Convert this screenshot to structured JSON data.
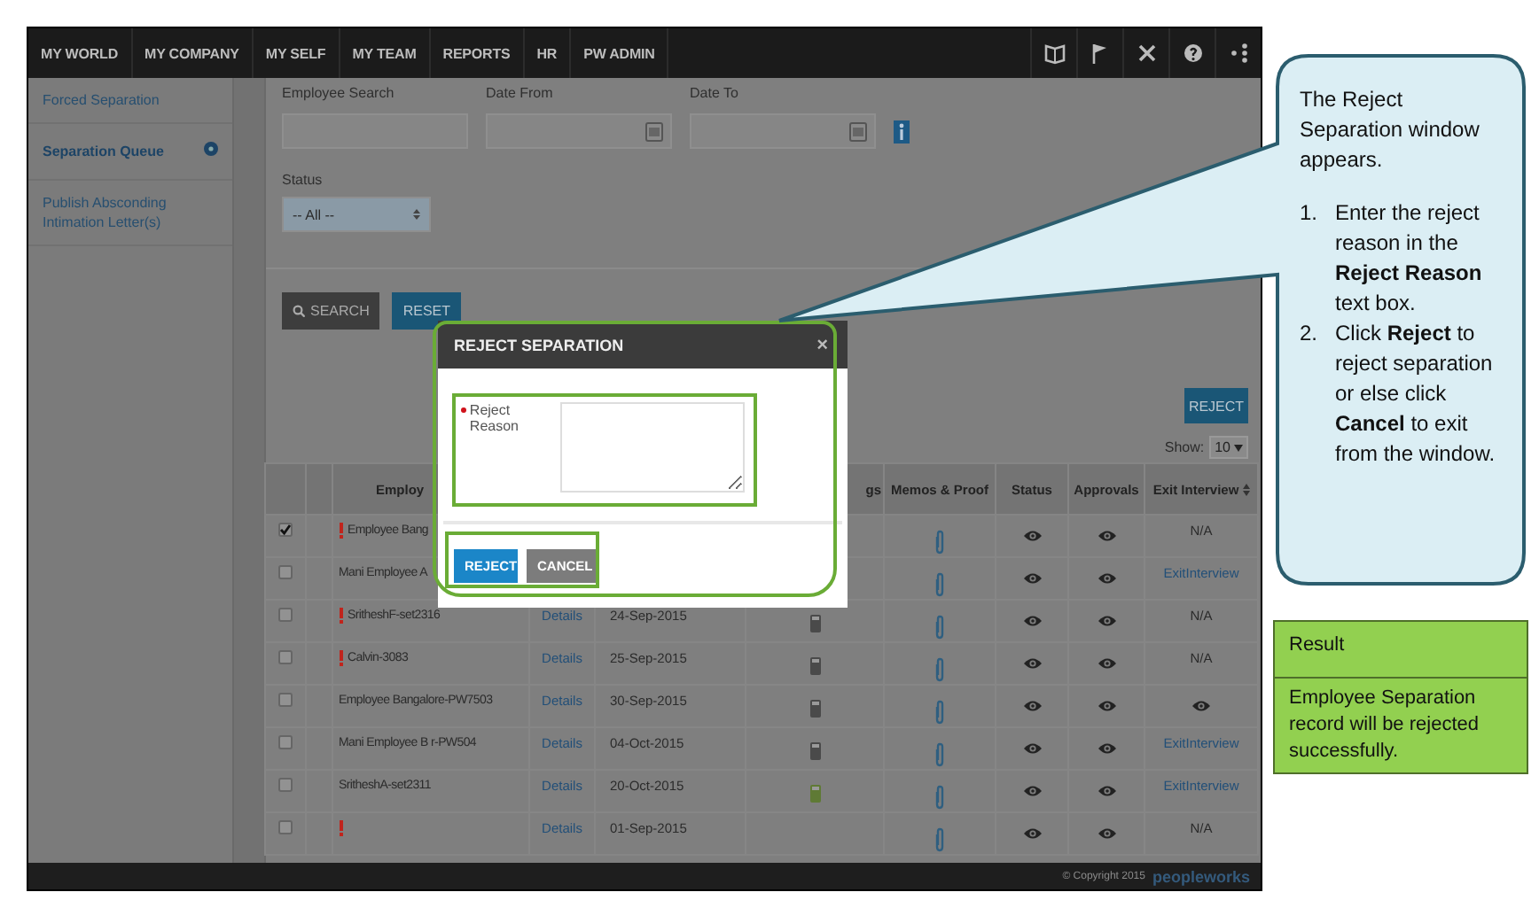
{
  "nav": {
    "items": [
      "MY WORLD",
      "MY COMPANY",
      "MY SELF",
      "MY TEAM",
      "REPORTS",
      "HR",
      "PW ADMIN"
    ]
  },
  "sidebar": {
    "items": [
      {
        "label": "Forced Separation",
        "selected": false
      },
      {
        "label": "Separation Queue",
        "selected": true
      },
      {
        "label": "Publish Absconding Intimation Letter(s)",
        "selected": false
      }
    ]
  },
  "filters": {
    "employee_search": {
      "label": "Employee Search"
    },
    "date_from": {
      "label": "Date From"
    },
    "date_to": {
      "label": "Date To"
    },
    "status": {
      "label": "Status",
      "value": "-- All --"
    },
    "search_button": "SEARCH",
    "reset_button": "RESET"
  },
  "reject_button": "REJECT",
  "show": {
    "label": "Show:",
    "value": "10"
  },
  "table": {
    "columns": {
      "column_3": "Employ",
      "column_6": "gs",
      "memos": "Memos & Proof",
      "status": "Status",
      "approvals": "Approvals",
      "exit_interview": "Exit Interview"
    },
    "rows": [
      {
        "checked": true,
        "flagged": true,
        "employee": "Employee Bang",
        "exit": {
          "kind": "text",
          "text": "N/A"
        }
      },
      {
        "checked": false,
        "flagged": false,
        "employee": "Mani Employee A",
        "exit": {
          "kind": "link",
          "text": "ExitInterview"
        }
      },
      {
        "checked": false,
        "flagged": true,
        "employee": "SritheshF-set2316",
        "details": "Details",
        "date": "24-Sep-2015",
        "color": "#4a4a4a",
        "exit": {
          "kind": "text",
          "text": "N/A"
        }
      },
      {
        "checked": false,
        "flagged": true,
        "employee": "Calvin-3083",
        "details": "Details",
        "date": "25-Sep-2015",
        "color": "#4a4a4a",
        "exit": {
          "kind": "text",
          "text": "N/A"
        }
      },
      {
        "checked": false,
        "flagged": false,
        "employee": "Employee Bangalore-PW7503",
        "details": "Details",
        "date": "30-Sep-2015",
        "color": "#4a4a4a",
        "exit": {
          "kind": "eye"
        }
      },
      {
        "checked": false,
        "flagged": false,
        "employee": "Mani Employee B r-PW504",
        "details": "Details",
        "date": "04-Oct-2015",
        "color": "#4a4a4a",
        "exit": {
          "kind": "link",
          "text": "ExitInterview"
        }
      },
      {
        "checked": false,
        "flagged": false,
        "employee": "SritheshA-set2311",
        "details": "Details",
        "date": "20-Oct-2015",
        "color": "#5f7a35",
        "exit": {
          "kind": "link",
          "text": "ExitInterview"
        }
      },
      {
        "checked": false,
        "flagged": true,
        "details": "Details",
        "date": "01-Sep-2015",
        "exit": {
          "kind": "text",
          "text": "N/A"
        }
      }
    ]
  },
  "footer": {
    "copyright": "© Copyright 2015",
    "logo": "peopleworks"
  },
  "dialog": {
    "title": "REJECT SEPARATION",
    "close": "×",
    "field_label": "Reject Reason",
    "required": true,
    "reject_button": "REJECT",
    "cancel_button": "CANCEL"
  },
  "callout": {
    "intro": "The Reject Separation window appears.",
    "steps": [
      {
        "number": "1.",
        "text": "Enter the reject reason in the **Reject Reason** text box."
      },
      {
        "number": "2.",
        "text": "Click **Reject** to reject separation or else click **Cancel** to exit from the window."
      }
    ]
  },
  "result": {
    "title": "Result",
    "text": "Employee Separation record will be rejected successfully."
  }
}
